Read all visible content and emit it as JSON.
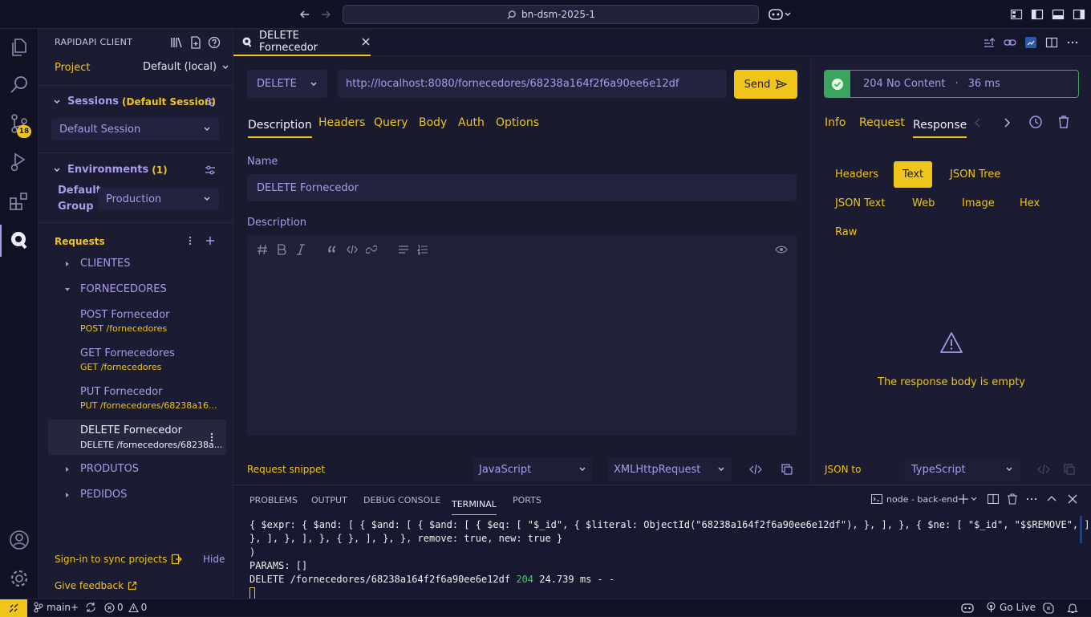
{
  "titlebar": {
    "search": "bn-dsm-2025-1"
  },
  "activity": {
    "badge": "18"
  },
  "sidebar": {
    "title": "RAPIDAPI CLIENT",
    "project_label": "Project",
    "project_value": "Default (local)",
    "sessions_label": "Sessions",
    "sessions_sub": "(Default Session)",
    "session_value": "Default Session",
    "env_label": "Environments",
    "env_count": "(1)",
    "env_group_1": "Default",
    "env_group_2": "Group",
    "env_value": "Production",
    "requests_label": "Requests",
    "groups": [
      "CLIENTES",
      "FORNECEDORES",
      "PRODUTOS",
      "PEDIDOS"
    ],
    "items": [
      {
        "name": "POST Fornecedor",
        "path": "POST /fornecedores"
      },
      {
        "name": "GET Fornecedores",
        "path": "GET /fornecedores"
      },
      {
        "name": "PUT Fornecedor",
        "path": "PUT /fornecedores/68238a16..."
      },
      {
        "name": "DELETE Fornecedor",
        "path": "DELETE /fornecedores/68238a..."
      }
    ],
    "signin": "Sign-in to sync projects",
    "hide": "Hide",
    "feedback": "Give feedback"
  },
  "tab": {
    "label": "DELETE Fornecedor"
  },
  "request": {
    "method": "DELETE",
    "url": "http://localhost:8080/fornecedores/68238a164f2f6a90ee6e12df",
    "send": "Send",
    "tabs": [
      "Description",
      "Headers",
      "Query",
      "Body",
      "Auth",
      "Options"
    ],
    "name_label": "Name",
    "name_value": "DELETE Fornecedor",
    "desc_label": "Description",
    "snippet_label": "Request snippet",
    "snippet_lang": "JavaScript",
    "snippet_lib": "XMLHttpRequest"
  },
  "response": {
    "status": "204 No Content",
    "sep": "·",
    "time": "36 ms",
    "tabs": [
      "Info",
      "Request",
      "Response"
    ],
    "formats": [
      "Headers",
      "Text",
      "JSON Tree",
      "JSON Text",
      "Web",
      "Image",
      "Hex",
      "Raw"
    ],
    "empty": "The response body is empty",
    "json_to": "JSON to",
    "lang": "TypeScript",
    "accent": "#f0c419",
    "success": "#3aa55d"
  },
  "panel": {
    "tabs": [
      "PROBLEMS",
      "OUTPUT",
      "DEBUG CONSOLE",
      "TERMINAL",
      "PORTS"
    ],
    "shell": "node - back-end",
    "line1": "{ $expr: { $and: [ { $and: [ { $and: [ { $eq: [ \"$_id\", { $literal: ObjectId(\"68238a164f2f6a90ee6e12df\"), }, ], }, { $ne: [ \"$_id\", \"$$REMOVE\", ],",
    "line2": "}, ], }, ], }, { }, ], }, }, remove: true, new: true }",
    "line3": ")",
    "line4": "PARAMS: []",
    "log_prefix": "DELETE /fornecedores/68238a164f2f6a90ee6e12df",
    "log_code": "204",
    "log_suffix": "24.739 ms - -"
  },
  "status": {
    "branch": "main+",
    "errors": "0",
    "warnings": "0",
    "golive": "Go Live"
  }
}
